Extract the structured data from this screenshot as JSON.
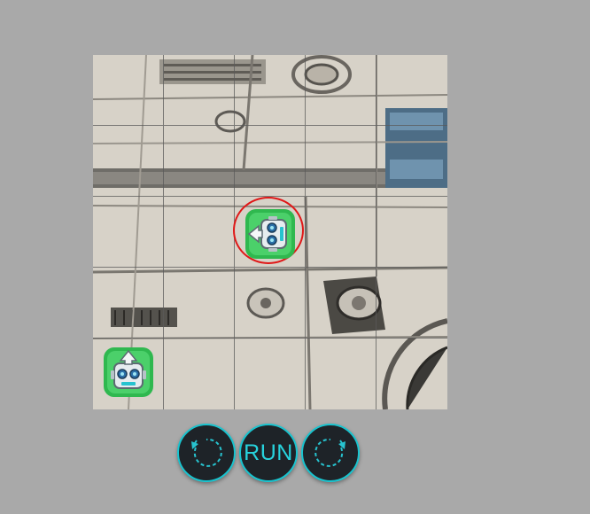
{
  "board": {
    "rows": 5,
    "cols": 5,
    "background": "metallic-spaceship-floor"
  },
  "goal_robot": {
    "icon": "robot-goal-icon",
    "row": 3,
    "col": 3,
    "facing": "left",
    "highlighted": true,
    "ring_color": "#e01818"
  },
  "player_robot": {
    "icon": "robot-player-icon",
    "row": 5,
    "col": 1,
    "facing": "up"
  },
  "controls": {
    "rotate_left_icon": "rotate-counterclockwise-icon",
    "run_label": "RUN",
    "rotate_right_icon": "rotate-clockwise-icon",
    "accent_color": "#19c4cf",
    "button_color": "#1e2328"
  }
}
